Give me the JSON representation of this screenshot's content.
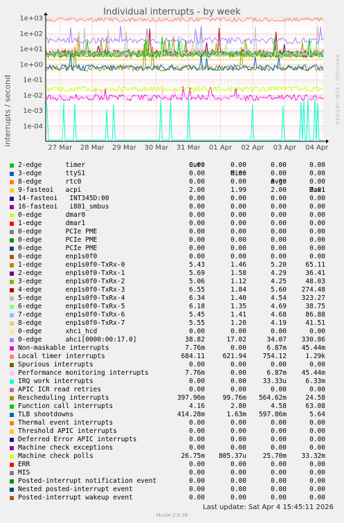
{
  "chart_data": {
    "type": "line",
    "title": "Individual interrupts - by week",
    "ylabel": "interrupts / second",
    "yscale": "log",
    "ylim": [
      1e-05,
      1000
    ],
    "y_ticks": [
      "1e+03",
      "1e+02",
      "1e+01",
      "1e+00",
      "1e-01",
      "1e-02",
      "1e-03",
      "1e-04"
    ],
    "x_ticks": [
      "27 Mar",
      "28 Mar",
      "29 Mar",
      "30 Mar",
      "31 Mar",
      "01 Apr",
      "02 Apr",
      "03 Apr",
      "04 Apr"
    ],
    "grid": true,
    "legend_columns": [
      "Cur:",
      "Min:",
      "Avg:",
      "Max:"
    ],
    "series": [
      {
        "name": "2-edge      timer",
        "color": "#00cc00",
        "cur": "0.00",
        "min": "0.00",
        "avg": "0.00",
        "max": "0.00"
      },
      {
        "name": "3-edge      ttyS1",
        "color": "#0066b3",
        "cur": "0.00",
        "min": "0.00",
        "avg": "0.00",
        "max": "0.00"
      },
      {
        "name": "8-edge      rtc0",
        "color": "#ff8000",
        "cur": "0.00",
        "min": "0.00",
        "avg": "0.00",
        "max": "0.00"
      },
      {
        "name": "9-fasteoi   acpi",
        "color": "#ffcc00",
        "cur": "2.00",
        "min": "1.99",
        "avg": "2.00",
        "max": "2.01"
      },
      {
        "name": "14-fasteoi   INT345D:00",
        "color": "#330099",
        "cur": "0.00",
        "min": "0.00",
        "avg": "0.00",
        "max": "0.00"
      },
      {
        "name": "16-fasteoi   i801_smbus",
        "color": "#990099",
        "cur": "0.00",
        "min": "0.00",
        "avg": "0.00",
        "max": "0.00"
      },
      {
        "name": "0-edge      dmar0",
        "color": "#ccff00",
        "cur": "0.00",
        "min": "0.00",
        "avg": "0.00",
        "max": "0.00"
      },
      {
        "name": "1-edge      dmar1",
        "color": "#ff0000",
        "cur": "0.00",
        "min": "0.00",
        "avg": "0.00",
        "max": "0.00"
      },
      {
        "name": "0-edge      PCIe PME",
        "color": "#808080",
        "cur": "0.00",
        "min": "0.00",
        "avg": "0.00",
        "max": "0.00"
      },
      {
        "name": "0-edge      PCIe PME",
        "color": "#008f00",
        "cur": "0.00",
        "min": "0.00",
        "avg": "0.00",
        "max": "0.00"
      },
      {
        "name": "0-edge      PCIe PME",
        "color": "#00487d",
        "cur": "0.00",
        "min": "0.00",
        "avg": "0.00",
        "max": "0.00"
      },
      {
        "name": "0-edge      enp1s0f0",
        "color": "#b35a00",
        "cur": "0.00",
        "min": "0.00",
        "avg": "0.00",
        "max": "0.00"
      },
      {
        "name": "1-edge      enp1s0f0-TxRx-0",
        "color": "#b38f00",
        "cur": "5.43",
        "min": "1.46",
        "avg": "5.20",
        "max": "65.11"
      },
      {
        "name": "2-edge      enp1s0f0-TxRx-1",
        "color": "#6b006b",
        "cur": "5.69",
        "min": "1.58",
        "avg": "4.29",
        "max": "36.41"
      },
      {
        "name": "3-edge      enp1s0f0-TxRx-2",
        "color": "#8fb300",
        "cur": "5.06",
        "min": "1.12",
        "avg": "4.25",
        "max": "48.03"
      },
      {
        "name": "4-edge      enp1s0f0-TxRx-3",
        "color": "#b30000",
        "cur": "6.55",
        "min": "1.84",
        "avg": "5.60",
        "max": "274.48"
      },
      {
        "name": "5-edge      enp1s0f0-TxRx-4",
        "color": "#bebebe",
        "cur": "6.34",
        "min": "1.40",
        "avg": "4.54",
        "max": "323.27"
      },
      {
        "name": "6-edge      enp1s0f0-TxRx-5",
        "color": "#80ff80",
        "cur": "6.18",
        "min": "1.35",
        "avg": "4.69",
        "max": "38.75"
      },
      {
        "name": "7-edge      enp1s0f0-TxRx-6",
        "color": "#80c9ff",
        "cur": "5.45",
        "min": "1.41",
        "avg": "4.68",
        "max": "86.88"
      },
      {
        "name": "8-edge      enp1s0f0-TxRx-7",
        "color": "#ffc080",
        "cur": "5.55",
        "min": "1.20",
        "avg": "4.19",
        "max": "41.51"
      },
      {
        "name": "0-edge      xhci_hcd",
        "color": "#ffe680",
        "cur": "0.00",
        "min": "0.00",
        "avg": "0.00",
        "max": "0.00"
      },
      {
        "name": "0-edge      ahci[0000:00:17.0]",
        "color": "#aa80ff",
        "cur": "38.82",
        "min": "17.02",
        "avg": "34.07",
        "max": "330.86"
      },
      {
        "name": "Non-maskable interrupts",
        "color": "#ee00cc",
        "cur": "7.76m",
        "min": "0.00",
        "avg": "6.87m",
        "max": "45.44m"
      },
      {
        "name": "Local timer interrupts",
        "color": "#ff8080",
        "cur": "684.11",
        "min": "621.94",
        "avg": "754.12",
        "max": "1.29k"
      },
      {
        "name": "Spurious interrupts",
        "color": "#666600",
        "cur": "0.00",
        "min": "0.00",
        "avg": "0.00",
        "max": "0.00"
      },
      {
        "name": "Performance monitoring interrupts",
        "color": "#ffbfff",
        "cur": "7.76m",
        "min": "0.00",
        "avg": "6.87m",
        "max": "45.44m"
      },
      {
        "name": "IRQ work interrupts",
        "color": "#00ffcc",
        "cur": "0.00",
        "min": "0.00",
        "avg": "33.33u",
        "max": "6.33m"
      },
      {
        "name": "APIC ICR read retries",
        "color": "#cc6699",
        "cur": "0.00",
        "min": "0.00",
        "avg": "0.00",
        "max": "0.00"
      },
      {
        "name": "Rescheduling interrupts",
        "color": "#999900",
        "cur": "397.96m",
        "min": "99.76m",
        "avg": "564.62m",
        "max": "24.58"
      },
      {
        "name": "Function call interrupts",
        "color": "#00cc00",
        "cur": "4.16",
        "min": "2.80",
        "avg": "4.58",
        "max": "63.08"
      },
      {
        "name": "TLB shootdowns",
        "color": "#0066b3",
        "cur": "414.28m",
        "min": "1.63m",
        "avg": "597.86m",
        "max": "5.64"
      },
      {
        "name": "Thermal event interrupts",
        "color": "#ff8000",
        "cur": "0.00",
        "min": "0.00",
        "avg": "0.00",
        "max": "0.00"
      },
      {
        "name": "Threshold APIC interrupts",
        "color": "#ffcc00",
        "cur": "0.00",
        "min": "0.00",
        "avg": "0.00",
        "max": "0.00"
      },
      {
        "name": "Deferred Error APIC interrupts",
        "color": "#330099",
        "cur": "0.00",
        "min": "0.00",
        "avg": "0.00",
        "max": "0.00"
      },
      {
        "name": "Machine check exceptions",
        "color": "#990099",
        "cur": "0.00",
        "min": "0.00",
        "avg": "0.00",
        "max": "0.00"
      },
      {
        "name": "Machine check polls",
        "color": "#ccff00",
        "cur": "26.75m",
        "min": "805.37u",
        "avg": "25.70m",
        "max": "33.32m"
      },
      {
        "name": "ERR",
        "color": "#ff0000",
        "cur": "0.00",
        "min": "0.00",
        "avg": "0.00",
        "max": "0.00"
      },
      {
        "name": "MIS",
        "color": "#808080",
        "cur": "0.00",
        "min": "0.00",
        "avg": "0.00",
        "max": "0.00"
      },
      {
        "name": "Posted-interrupt notification event",
        "color": "#008f00",
        "cur": "0.00",
        "min": "0.00",
        "avg": "0.00",
        "max": "0.00"
      },
      {
        "name": "Nested posted-interrupt event",
        "color": "#00487d",
        "cur": "0.00",
        "min": "0.00",
        "avg": "0.00",
        "max": "0.00"
      },
      {
        "name": "Posted-interrupt wakeup event",
        "color": "#b35a00",
        "cur": "0.00",
        "min": "0.00",
        "avg": "0.00",
        "max": "0.00"
      }
    ]
  },
  "side_label": "RRDTOOL / TOBI OETIKER",
  "last_update": "Last update: Sat Apr  4 15:45:11 2026",
  "footer": "Munin 2.0.76"
}
